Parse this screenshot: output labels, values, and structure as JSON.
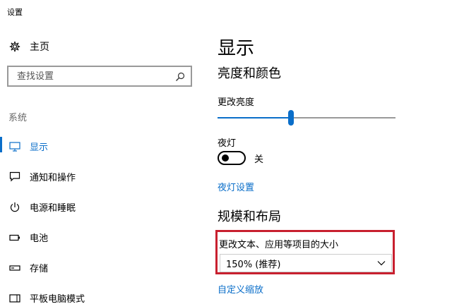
{
  "window": {
    "title": "设置"
  },
  "sidebar": {
    "home_label": "主页",
    "search_placeholder": "查找设置",
    "section_label": "系统",
    "items": [
      {
        "label": "显示",
        "icon": "monitor-icon",
        "active": true
      },
      {
        "label": "通知和操作",
        "icon": "message-icon",
        "active": false
      },
      {
        "label": "电源和睡眠",
        "icon": "power-icon",
        "active": false
      },
      {
        "label": "电池",
        "icon": "battery-icon",
        "active": false
      },
      {
        "label": "存储",
        "icon": "storage-icon",
        "active": false
      },
      {
        "label": "平板电脑模式",
        "icon": "tablet-icon",
        "active": false
      }
    ]
  },
  "main": {
    "title": "显示",
    "brightness_section": "亮度和颜色",
    "brightness_label": "更改亮度",
    "brightness_value": 0.41,
    "night_light_label": "夜灯",
    "night_light_state": "关",
    "night_light_settings_link": "夜灯设置",
    "scale_section": "规模和布局",
    "scale_label": "更改文本、应用等项目的大小",
    "scale_value": "150% (推荐)",
    "custom_scale_link": "自定义缩放"
  },
  "colors": {
    "accent": "#0a6ec9",
    "highlight_border": "#c8202f"
  }
}
